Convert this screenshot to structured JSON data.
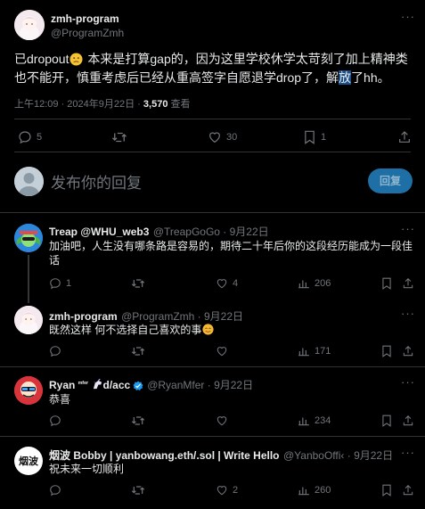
{
  "main_post": {
    "author_name": "zmh-program",
    "author_handle": "@ProgramZmh",
    "text_before_emoji": "已dropout",
    "text_after_emoji": " 本来是打算gap的，因为这里学校休学太苛刻了加上精神类也不能开，慎重考虑后已经从重高签字自愿退学drop了，解",
    "text_highlight": "放",
    "text_end": "了hh。",
    "timestamp": "上午12:09 · 2024年9月22日 · ",
    "views_count": "3,570",
    "views_label": " 查看",
    "replies": "5",
    "retweets": "",
    "likes": "30",
    "bookmarks": "1"
  },
  "composer": {
    "placeholder": "发布你的回复",
    "reply_button": "回复"
  },
  "replies": [
    {
      "name": "Treap @WHU_web3",
      "handle": "@TreapGoGo · 9月22日",
      "text": "加油吧，人生没有哪条路是容易的，期待二十年后你的这段经历能成为一段佳话",
      "replies": "1",
      "retweets": "",
      "likes": "4",
      "views": "206"
    },
    {
      "name": "zmh-program",
      "handle": "@ProgramZmh · 9月22日",
      "text": "既然这样 何不选择自己喜欢的事",
      "replies": "",
      "retweets": "",
      "likes": "",
      "views": "171"
    },
    {
      "name_part1": "Ryan ",
      "name_mfer": "ᵐᶠᵉʳ",
      "name_part2": "d/acc",
      "handle": "@RyanMfer · 9月22日",
      "text": "恭喜",
      "replies": "",
      "retweets": "",
      "likes": "",
      "views": "234"
    },
    {
      "name": "烟波 Bobby | yanbowang.eth/.sol | Write Hello",
      "handle": "@YanboOffi‹ · 9月22日",
      "avatar_text": "烟波",
      "text": "祝未来一切顺利",
      "replies": "",
      "retweets": "",
      "likes": "2",
      "views": "260"
    }
  ],
  "colors": {
    "background": "#000000",
    "text": "#e7e9ea",
    "muted": "#71767b",
    "divider": "#2f3336",
    "reply_button": "#1d6fa5",
    "verified": "#1d9bf0"
  }
}
